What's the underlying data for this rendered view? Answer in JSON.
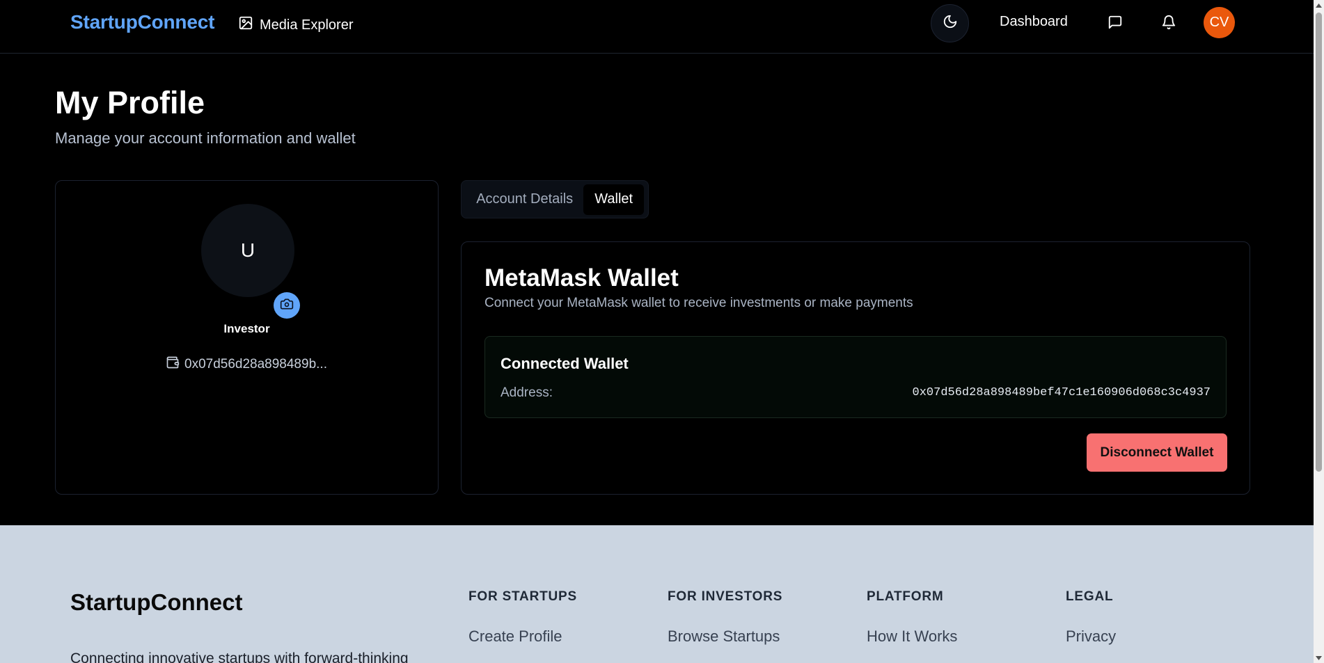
{
  "header": {
    "brand": "StartupConnect",
    "media_link": "Media Explorer",
    "dashboard_link": "Dashboard",
    "user_initials": "CV",
    "icons": [
      "image-icon",
      "moon-icon",
      "message-icon",
      "bell-icon"
    ]
  },
  "page": {
    "title": "My Profile",
    "subtitle": "Manage your account information and wallet"
  },
  "profile": {
    "avatar_initial": "U",
    "role": "Investor",
    "wallet_short": "0x07d56d28a898489b..."
  },
  "tabs": [
    {
      "label": "Account Details",
      "active": false
    },
    {
      "label": "Wallet",
      "active": true
    }
  ],
  "wallet": {
    "title": "MetaMask Wallet",
    "description": "Connect your MetaMask wallet to receive investments or make payments",
    "connected_title": "Connected Wallet",
    "address_label": "Address:",
    "address": "0x07d56d28a898489bef47c1e160906d068c3c4937",
    "disconnect_label": "Disconnect Wallet"
  },
  "footer": {
    "brand": "StartupConnect",
    "tagline": "Connecting innovative startups with forward-thinking",
    "columns": [
      {
        "heading": "FOR STARTUPS",
        "link": "Create Profile"
      },
      {
        "heading": "FOR INVESTORS",
        "link": "Browse Startups"
      },
      {
        "heading": "PLATFORM",
        "link": "How It Works"
      },
      {
        "heading": "LEGAL",
        "link": "Privacy"
      }
    ]
  },
  "colors": {
    "brand": "#60a5fa",
    "avatar": "#ea580c",
    "danger": "#f87171",
    "footer_bg": "#cbd5e1"
  }
}
